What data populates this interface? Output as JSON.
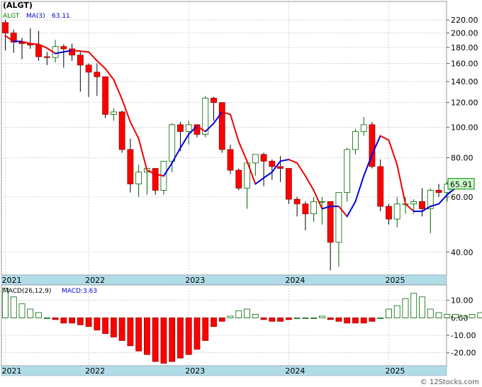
{
  "chart_data": [
    {
      "type": "candlestick",
      "title": "(ALGT)",
      "legend": [
        {
          "label": "ALGT",
          "color": "#008000"
        },
        {
          "label": "MA(3)",
          "color": "#0000cc"
        },
        {
          "label": "63.11",
          "color": "#0000cc"
        }
      ],
      "y_scale": "log",
      "ylim": [
        34,
        232
      ],
      "y_ticks": [
        "220.00",
        "200.00",
        "180.00",
        "160.00",
        "140.00",
        "120.00",
        "100.00",
        "80.00",
        "60.00",
        "40.00"
      ],
      "y_tick_values": [
        220,
        200,
        180,
        160,
        140,
        120,
        100,
        80,
        60,
        40
      ],
      "x_labels": [
        "2021",
        "2022",
        "2023",
        "2024",
        "2025"
      ],
      "x_label_months": [
        0,
        10,
        22,
        34,
        46
      ],
      "last_price_label": "65.91",
      "up_color": "#ffffff",
      "down_color": "#ff0000",
      "series": [
        {
          "name": "ALGT",
          "ohlc": [
            [
              216,
              220,
              176,
              200
            ],
            [
              200,
              205,
              173,
              187
            ],
            [
              187,
              193,
              165,
              185
            ],
            [
              185,
              207,
              178,
              183
            ],
            [
              183,
              203,
              163,
              168
            ],
            [
              168,
              174,
              158,
              167
            ],
            [
              167,
              190,
              161,
              181
            ],
            [
              181,
              184,
              155,
              178
            ],
            [
              178,
              185,
              163,
              170
            ],
            [
              170,
              174,
              130,
              158
            ],
            [
              158,
              160,
              125,
              150
            ],
            [
              150,
              160,
              126,
              145
            ],
            [
              145,
              145,
              107,
              110
            ],
            [
              110,
              115,
              105,
              112
            ],
            [
              112,
              113,
              83,
              85
            ],
            [
              85,
              92,
              62,
              66
            ],
            [
              66,
              76,
              60,
              72
            ],
            [
              72,
              73,
              61,
              74
            ],
            [
              74,
              74,
              61,
              63
            ],
            [
              63,
              78,
              61,
              78
            ],
            [
              78,
              103,
              72,
              102
            ],
            [
              102,
              104,
              84,
              97
            ],
            [
              97,
              105,
              88,
              102
            ],
            [
              102,
              102,
              93,
              95
            ],
            [
              95,
              126,
              93,
              124
            ],
            [
              124,
              125,
              105,
              120
            ],
            [
              120,
              120,
              83,
              85
            ],
            [
              85,
              88,
              71,
              73
            ],
            [
              73,
              74,
              63,
              64
            ],
            [
              64,
              76,
              55,
              77
            ],
            [
              77,
              82,
              70,
              82
            ],
            [
              82,
              83,
              65,
              78
            ],
            [
              78,
              79,
              68,
              75
            ],
            [
              75,
              81,
              67,
              74
            ],
            [
              74,
              74,
              57,
              59
            ],
            [
              59,
              60,
              52,
              57
            ],
            [
              57,
              58,
              47,
              53
            ],
            [
              53,
              60,
              50,
              58
            ],
            [
              58,
              60,
              49,
              58
            ],
            [
              58,
              58,
              35,
              43
            ],
            [
              43,
              61,
              36,
              62
            ],
            [
              62,
              86,
              58,
              85
            ],
            [
              85,
              99,
              82,
              97
            ],
            [
              97,
              108,
              94,
              102
            ],
            [
              102,
              104,
              74,
              75
            ],
            [
              75,
              79,
              54,
              56
            ],
            [
              56,
              57,
              49,
              51
            ],
            [
              51,
              60,
              48,
              57
            ],
            [
              57,
              60,
              53,
              57
            ],
            [
              57,
              59,
              53,
              58
            ],
            [
              58,
              64,
              52,
              55
            ],
            [
              55,
              64,
              46,
              63
            ],
            [
              63,
              66,
              60,
              62
            ],
            [
              62,
              67,
              58,
              65.91
            ]
          ]
        },
        {
          "name": "MA(3)",
          "values": [
            196,
            188,
            188,
            185,
            184,
            179,
            172,
            174,
            176,
            175,
            174,
            163,
            154,
            142,
            123,
            104,
            92,
            73,
            71,
            70,
            77,
            86,
            95,
            101,
            97,
            103,
            112,
            110,
            90,
            78,
            66,
            69,
            72,
            78,
            79,
            77,
            70,
            63,
            55,
            56,
            56,
            52,
            58,
            70,
            82,
            94,
            91,
            76,
            57,
            54,
            54,
            56,
            57,
            61,
            64
          ]
        }
      ]
    },
    {
      "type": "bar",
      "title": "MACD(26,12,9)",
      "legend": [
        {
          "label": "MACD(26,12,9)",
          "color": "#000000"
        },
        {
          "label": "MACD:3.63",
          "color": "#0000cc"
        }
      ],
      "ylim": [
        -27,
        18
      ],
      "y_ticks": [
        "10.00",
        "0.00",
        "-10.00",
        "-20.00"
      ],
      "y_tick_values": [
        10,
        0,
        -10,
        -20
      ],
      "x_labels": [
        "2021",
        "2022",
        "2023",
        "2024",
        "2025"
      ],
      "x_label_months": [
        0,
        10,
        22,
        34,
        46
      ],
      "positive_color": "#ffffff",
      "negative_color": "#ff0000",
      "values": [
        17,
        12,
        8,
        5,
        3,
        0,
        -1,
        -3,
        -3,
        -4,
        -5,
        -7,
        -9,
        -11,
        -13,
        -16,
        -19,
        -21,
        -25,
        -26,
        -25,
        -23,
        -21,
        -18,
        -13,
        -5,
        -2,
        1,
        4,
        5,
        2,
        -1,
        -2,
        -2,
        -1,
        0,
        0,
        0,
        1,
        -1,
        -2,
        -3,
        -3,
        -3,
        -2,
        0,
        5,
        7,
        11,
        14,
        12,
        5,
        3,
        2,
        2,
        1,
        2,
        3,
        3,
        3.63
      ]
    }
  ],
  "footer": {
    "watermark": "© 12Stocks.com"
  }
}
